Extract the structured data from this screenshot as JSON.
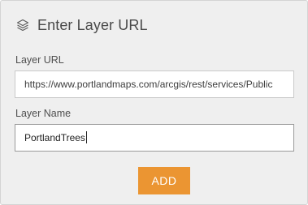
{
  "dialog": {
    "title": "Enter Layer URL",
    "header_icon": "layers-icon"
  },
  "layer_url": {
    "label": "Layer URL",
    "value": "https://www.portlandmaps.com/arcgis/rest/services/Public"
  },
  "layer_name": {
    "label": "Layer Name",
    "value": "PortlandTrees"
  },
  "actions": {
    "add_label": "ADD"
  },
  "colors": {
    "accent": "#eb9532",
    "panel_bg": "#efefef",
    "text": "#4a4a4a"
  }
}
